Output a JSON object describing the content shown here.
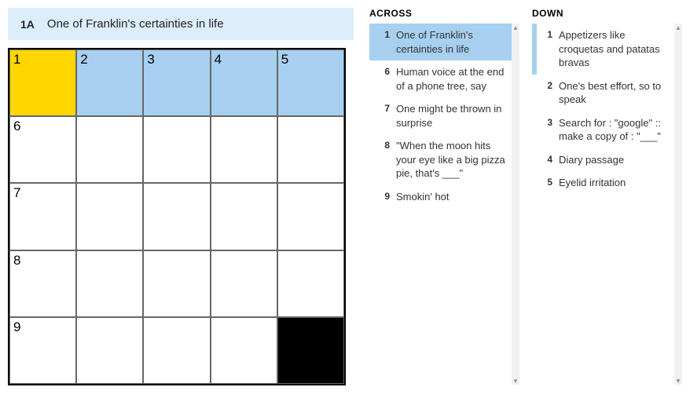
{
  "current_clue": {
    "label": "1A",
    "text": "One of Franklin's certainties in life"
  },
  "grid": {
    "size": 5,
    "cells": [
      {
        "r": 0,
        "c": 0,
        "num": "1",
        "state": "focus"
      },
      {
        "r": 0,
        "c": 1,
        "num": "2",
        "state": "hl"
      },
      {
        "r": 0,
        "c": 2,
        "num": "3",
        "state": "hl"
      },
      {
        "r": 0,
        "c": 3,
        "num": "4",
        "state": "hl"
      },
      {
        "r": 0,
        "c": 4,
        "num": "5",
        "state": "hl"
      },
      {
        "r": 1,
        "c": 0,
        "num": "6",
        "state": ""
      },
      {
        "r": 1,
        "c": 1,
        "num": "",
        "state": ""
      },
      {
        "r": 1,
        "c": 2,
        "num": "",
        "state": ""
      },
      {
        "r": 1,
        "c": 3,
        "num": "",
        "state": ""
      },
      {
        "r": 1,
        "c": 4,
        "num": "",
        "state": ""
      },
      {
        "r": 2,
        "c": 0,
        "num": "7",
        "state": ""
      },
      {
        "r": 2,
        "c": 1,
        "num": "",
        "state": ""
      },
      {
        "r": 2,
        "c": 2,
        "num": "",
        "state": ""
      },
      {
        "r": 2,
        "c": 3,
        "num": "",
        "state": ""
      },
      {
        "r": 2,
        "c": 4,
        "num": "",
        "state": ""
      },
      {
        "r": 3,
        "c": 0,
        "num": "8",
        "state": ""
      },
      {
        "r": 3,
        "c": 1,
        "num": "",
        "state": ""
      },
      {
        "r": 3,
        "c": 2,
        "num": "",
        "state": ""
      },
      {
        "r": 3,
        "c": 3,
        "num": "",
        "state": ""
      },
      {
        "r": 3,
        "c": 4,
        "num": "",
        "state": ""
      },
      {
        "r": 4,
        "c": 0,
        "num": "9",
        "state": ""
      },
      {
        "r": 4,
        "c": 1,
        "num": "",
        "state": ""
      },
      {
        "r": 4,
        "c": 2,
        "num": "",
        "state": ""
      },
      {
        "r": 4,
        "c": 3,
        "num": "",
        "state": ""
      },
      {
        "r": 4,
        "c": 4,
        "num": "",
        "state": "black"
      }
    ]
  },
  "across": {
    "heading": "ACROSS",
    "clues": [
      {
        "num": "1",
        "text": "One of Franklin's certainties in life",
        "state": "active"
      },
      {
        "num": "6",
        "text": "Human voice at the end of a phone tree, say",
        "state": ""
      },
      {
        "num": "7",
        "text": "One might be thrown in surprise",
        "state": ""
      },
      {
        "num": "8",
        "text": "\"When the moon hits your eye like a big pizza pie, that's ___\"",
        "state": ""
      },
      {
        "num": "9",
        "text": "Smokin' hot",
        "state": ""
      }
    ]
  },
  "down": {
    "heading": "DOWN",
    "clues": [
      {
        "num": "1",
        "text": "Appetizers like croquetas and patatas bravas",
        "state": "related"
      },
      {
        "num": "2",
        "text": "One's best effort, so to speak",
        "state": ""
      },
      {
        "num": "3",
        "text": "Search for : \"google\" :: make a copy of : \"___\"",
        "state": ""
      },
      {
        "num": "4",
        "text": "Diary passage",
        "state": ""
      },
      {
        "num": "5",
        "text": "Eyelid irritation",
        "state": ""
      }
    ]
  }
}
